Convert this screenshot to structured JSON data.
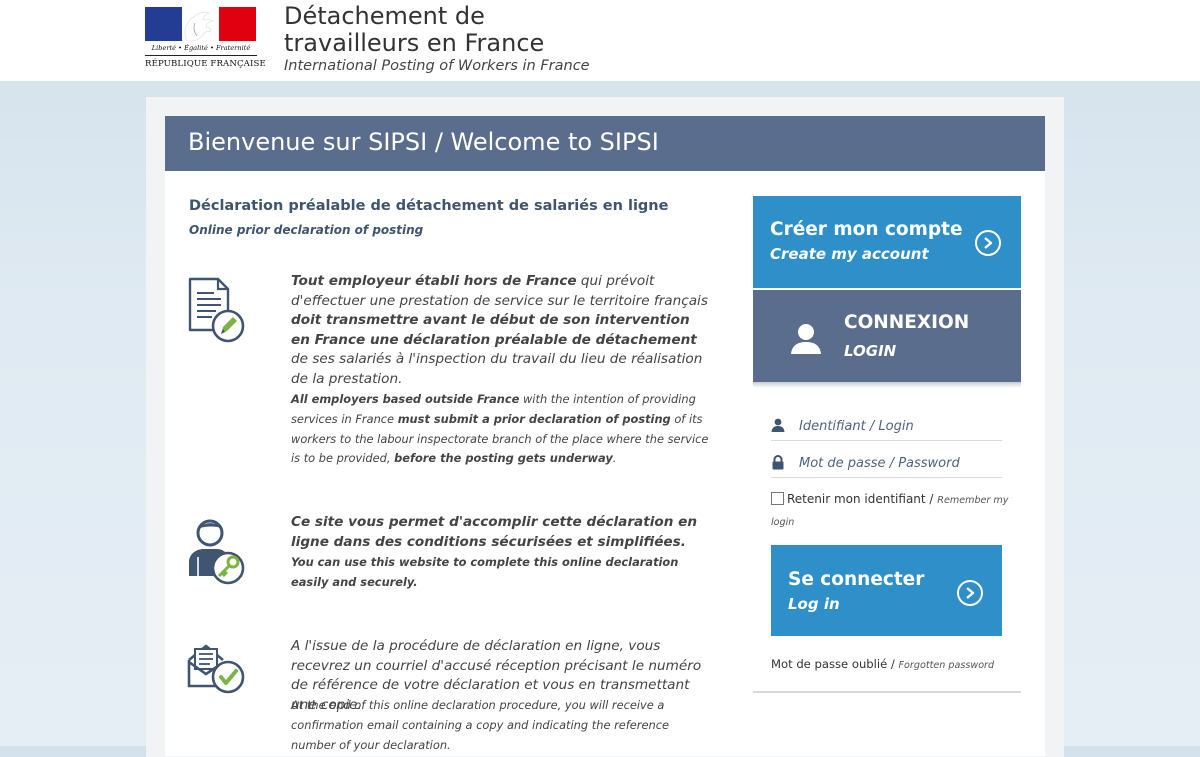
{
  "header": {
    "flag_motto": "Liberté • Égalité • Fraternité",
    "republique": "RÉPUBLIQUE FRANÇAISE",
    "title_line1": "Détachement de",
    "title_line2": "travailleurs en France",
    "subtitle": "International Posting of Workers in France"
  },
  "banner": {
    "title": "Bienvenue sur SIPSI / Welcome to SIPSI"
  },
  "intro": {
    "title": "Déclaration préalable de détachement de salariés en ligne",
    "subtitle": "Online prior declaration of posting"
  },
  "blocks": [
    {
      "icon": "document-pencil-icon",
      "fr_bold1": "Tout employeur établi hors de France",
      "fr_text1": " qui prévoit d'effectuer une prestation de service sur le territoire français ",
      "fr_bold2": "doit transmettre avant le début de son intervention en France une déclaration préalable de détachement",
      "fr_text2": " de ses salariés à l'inspection du travail du lieu de réalisation de la prestation.",
      "en_bold1": "All employers based outside France",
      "en_text1": " with the intention of providing services in France ",
      "en_bold2": "must submit a prior declaration of posting",
      "en_text2": " of its workers to the labour inspectorate branch of the place where the service is to be provided, ",
      "en_bold3": "before the posting gets underway",
      "en_text3": "."
    },
    {
      "icon": "user-key-icon",
      "fr_bold": "Ce site vous permet d'accomplir cette déclaration en ligne dans des conditions sécurisées et simplifiées.",
      "en_bold": "You can use this website to complete this online declaration easily and securely."
    },
    {
      "icon": "mail-check-icon",
      "fr_text": "A l'issue de la procédure de déclaration en ligne, vous recevrez un courriel d'accusé réception précisant le numéro de référence de votre déclaration et vous en transmettant une copie.",
      "en_text": "At the end of this online declaration procedure, you will receive a confirmation email containing a copy and indicating the reference number of your declaration."
    }
  ],
  "create_account": {
    "label_fr": "Créer mon compte",
    "label_en": "Create my account"
  },
  "login_panel": {
    "label_fr": "CONNEXION",
    "label_en": "LOGIN"
  },
  "form": {
    "login_placeholder": "Identifiant / Login",
    "password_placeholder": "Mot de passe / Password",
    "remember_fr": "Retenir mon identifiant / ",
    "remember_en": "Remember my login",
    "remember_checked": false
  },
  "connect_button": {
    "label_fr": "Se connecter",
    "label_en": "Log in"
  },
  "forgot": {
    "label_fr": "Mot de passe oublié / ",
    "label_en": "Forgotten password"
  },
  "colors": {
    "banner": "#5b6d8d",
    "primary_button": "#2f8fc8",
    "heading_text": "#3f556f",
    "icon_green": "#7cb342",
    "icon_dark": "#3f5570"
  }
}
